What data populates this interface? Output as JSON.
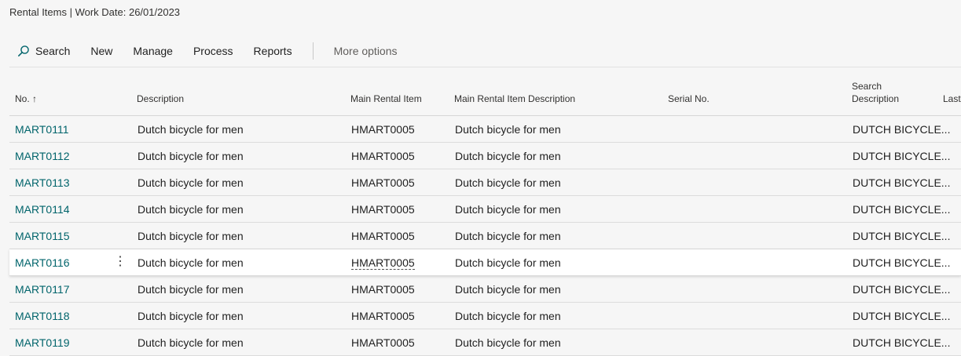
{
  "page": {
    "title": "Rental Items | Work Date: 26/01/2023"
  },
  "toolbar": {
    "search_label": "Search",
    "new_label": "New",
    "manage_label": "Manage",
    "process_label": "Process",
    "reports_label": "Reports",
    "more_label": "More options"
  },
  "table": {
    "headers": {
      "no": "No. ↑",
      "description": "Description",
      "main_item": "Main Rental Item",
      "main_item_desc": "Main Rental Item Description",
      "serial": "Serial No.",
      "search_desc_1": "Search",
      "search_desc_2": "Description",
      "last": "Last"
    },
    "rows": [
      {
        "no": "MART0111",
        "description": "Dutch bicycle for men",
        "main_item": "HMART0005",
        "main_item_desc": "Dutch bicycle for men",
        "serial": "",
        "search_desc": "DUTCH BICYCLE..."
      },
      {
        "no": "MART0112",
        "description": "Dutch bicycle for men",
        "main_item": "HMART0005",
        "main_item_desc": "Dutch bicycle for men",
        "serial": "",
        "search_desc": "DUTCH BICYCLE..."
      },
      {
        "no": "MART0113",
        "description": "Dutch bicycle for men",
        "main_item": "HMART0005",
        "main_item_desc": "Dutch bicycle for men",
        "serial": "",
        "search_desc": "DUTCH BICYCLE..."
      },
      {
        "no": "MART0114",
        "description": "Dutch bicycle for men",
        "main_item": "HMART0005",
        "main_item_desc": "Dutch bicycle for men",
        "serial": "",
        "search_desc": "DUTCH BICYCLE..."
      },
      {
        "no": "MART0115",
        "description": "Dutch bicycle for men",
        "main_item": "HMART0005",
        "main_item_desc": "Dutch bicycle for men",
        "serial": "",
        "search_desc": "DUTCH BICYCLE..."
      },
      {
        "no": "MART0116",
        "description": "Dutch bicycle for men",
        "main_item": "HMART0005",
        "main_item_desc": "Dutch bicycle for men",
        "serial": "",
        "search_desc": "DUTCH BICYCLE...",
        "selected": true
      },
      {
        "no": "MART0117",
        "description": "Dutch bicycle for men",
        "main_item": "HMART0005",
        "main_item_desc": "Dutch bicycle for men",
        "serial": "",
        "search_desc": "DUTCH BICYCLE..."
      },
      {
        "no": "MART0118",
        "description": "Dutch bicycle for men",
        "main_item": "HMART0005",
        "main_item_desc": "Dutch bicycle for men",
        "serial": "",
        "search_desc": "DUTCH BICYCLE..."
      },
      {
        "no": "MART0119",
        "description": "Dutch bicycle for men",
        "main_item": "HMART0005",
        "main_item_desc": "Dutch bicycle for men",
        "serial": "",
        "search_desc": "DUTCH BICYCLE..."
      }
    ]
  },
  "colors": {
    "link": "#00646b",
    "background": "#f6f6f6",
    "selected_row": "#ffffff"
  },
  "icons": {
    "search": "search-icon",
    "row_menu": "more-vertical-icon"
  }
}
